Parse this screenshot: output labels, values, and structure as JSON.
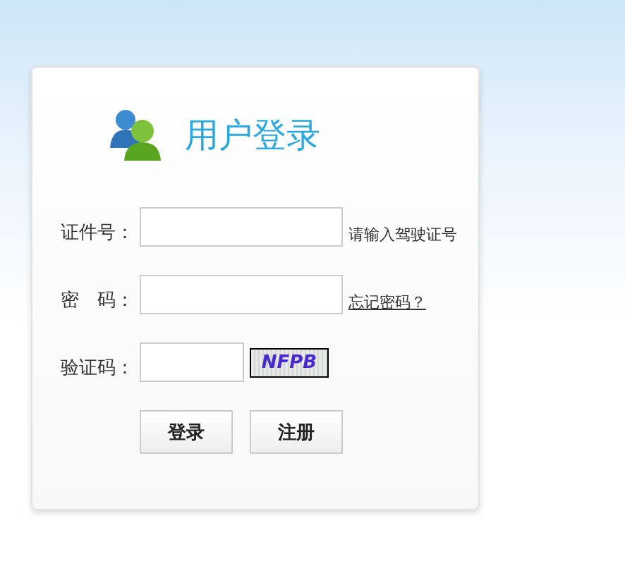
{
  "panel": {
    "title": "用户登录"
  },
  "fields": [
    {
      "kind": "text",
      "label": "证件号：",
      "hint": "请输入驾驶证号"
    },
    {
      "kind": "password",
      "label": "密　码：",
      "link": "忘记密码？"
    },
    {
      "kind": "captcha",
      "label": "验证码：",
      "captcha": "NFPB"
    }
  ],
  "buttons": [
    "登录",
    "注册"
  ]
}
